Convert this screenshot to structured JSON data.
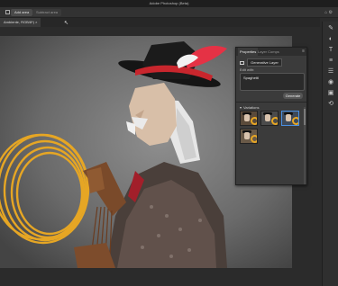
{
  "window": {
    "title": "Adobe Photoshop (Beta)"
  },
  "options_bar": {
    "add_label": "Add area",
    "subtract_label": "Subtract area"
  },
  "document": {
    "tab_label": "Ambiente, RGB/8*) ×"
  },
  "properties_panel": {
    "tabs": [
      "Properties",
      "Layer Comps"
    ],
    "layer_type": "Generative Layer",
    "edit_label": "Edit with:",
    "prompt_value": "Spaghetti",
    "generate_label": "Generate",
    "variations_label": "Variations",
    "variation_count": 4,
    "selected_variation": 3
  },
  "colors": {
    "accent": "#4a8fe0",
    "rope": "#e6a624",
    "hat_band": "#c8262d",
    "feather": "#e53245",
    "panel_bg": "#3b3b3b"
  }
}
